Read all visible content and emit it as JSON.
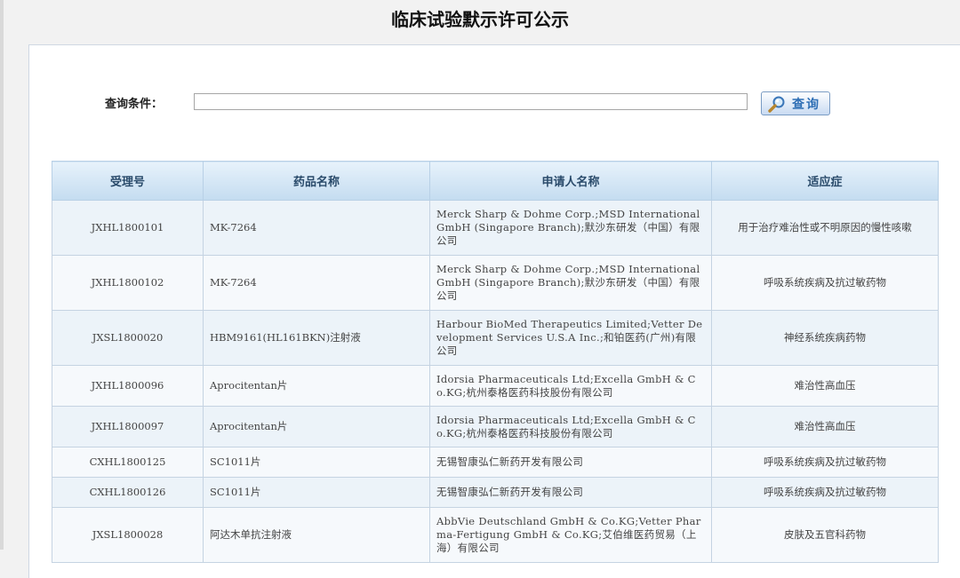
{
  "page": {
    "title": "临床试验默示许可公示"
  },
  "search": {
    "label": "查询条件：",
    "value": "",
    "placeholder": "",
    "button_label": "查询",
    "button_icon": "magnifier-icon"
  },
  "table": {
    "headers": {
      "acceptance_no": "受理号",
      "drug_name": "药品名称",
      "applicant": "申请人名称",
      "indication": "适应症"
    },
    "rows": [
      {
        "acceptance_no": "JXHL1800101",
        "drug_name": "MK-7264",
        "applicant": "Merck Sharp & Dohme Corp.;MSD International GmbH (Singapore Branch);默沙东研发（中国）有限公司",
        "indication": "用于治疗难治性或不明原因的慢性咳嗽"
      },
      {
        "acceptance_no": "JXHL1800102",
        "drug_name": "MK-7264",
        "applicant": "Merck Sharp & Dohme Corp.;MSD International GmbH (Singapore Branch);默沙东研发（中国）有限公司",
        "indication": "呼吸系统疾病及抗过敏药物"
      },
      {
        "acceptance_no": "JXSL1800020",
        "drug_name": "HBM9161(HL161BKN)注射液",
        "applicant": "Harbour BioMed Therapeutics Limited;Vetter Development Services U.S.A Inc.;和铂医药(广州)有限公司",
        "indication": "神经系统疾病药物"
      },
      {
        "acceptance_no": "JXHL1800096",
        "drug_name": "Aprocitentan片",
        "applicant": "Idorsia Pharmaceuticals Ltd;Excella GmbH & Co.KG;杭州泰格医药科技股份有限公司",
        "indication": "难治性高血压"
      },
      {
        "acceptance_no": "JXHL1800097",
        "drug_name": "Aprocitentan片",
        "applicant": "Idorsia Pharmaceuticals Ltd;Excella GmbH & Co.KG;杭州泰格医药科技股份有限公司",
        "indication": "难治性高血压"
      },
      {
        "acceptance_no": "CXHL1800125",
        "drug_name": "SC1011片",
        "applicant": "无锡智康弘仁新药开发有限公司",
        "indication": "呼吸系统疾病及抗过敏药物"
      },
      {
        "acceptance_no": "CXHL1800126",
        "drug_name": "SC1011片",
        "applicant": "无锡智康弘仁新药开发有限公司",
        "indication": "呼吸系统疾病及抗过敏药物"
      },
      {
        "acceptance_no": "JXSL1800028",
        "drug_name": "阿达木单抗注射液",
        "applicant": "AbbVie Deutschland GmbH & Co.KG;Vetter Pharma-Fertigung GmbH & Co.KG;艾伯维医药贸易（上海）有限公司",
        "indication": "皮肤及五官科药物"
      }
    ]
  }
}
